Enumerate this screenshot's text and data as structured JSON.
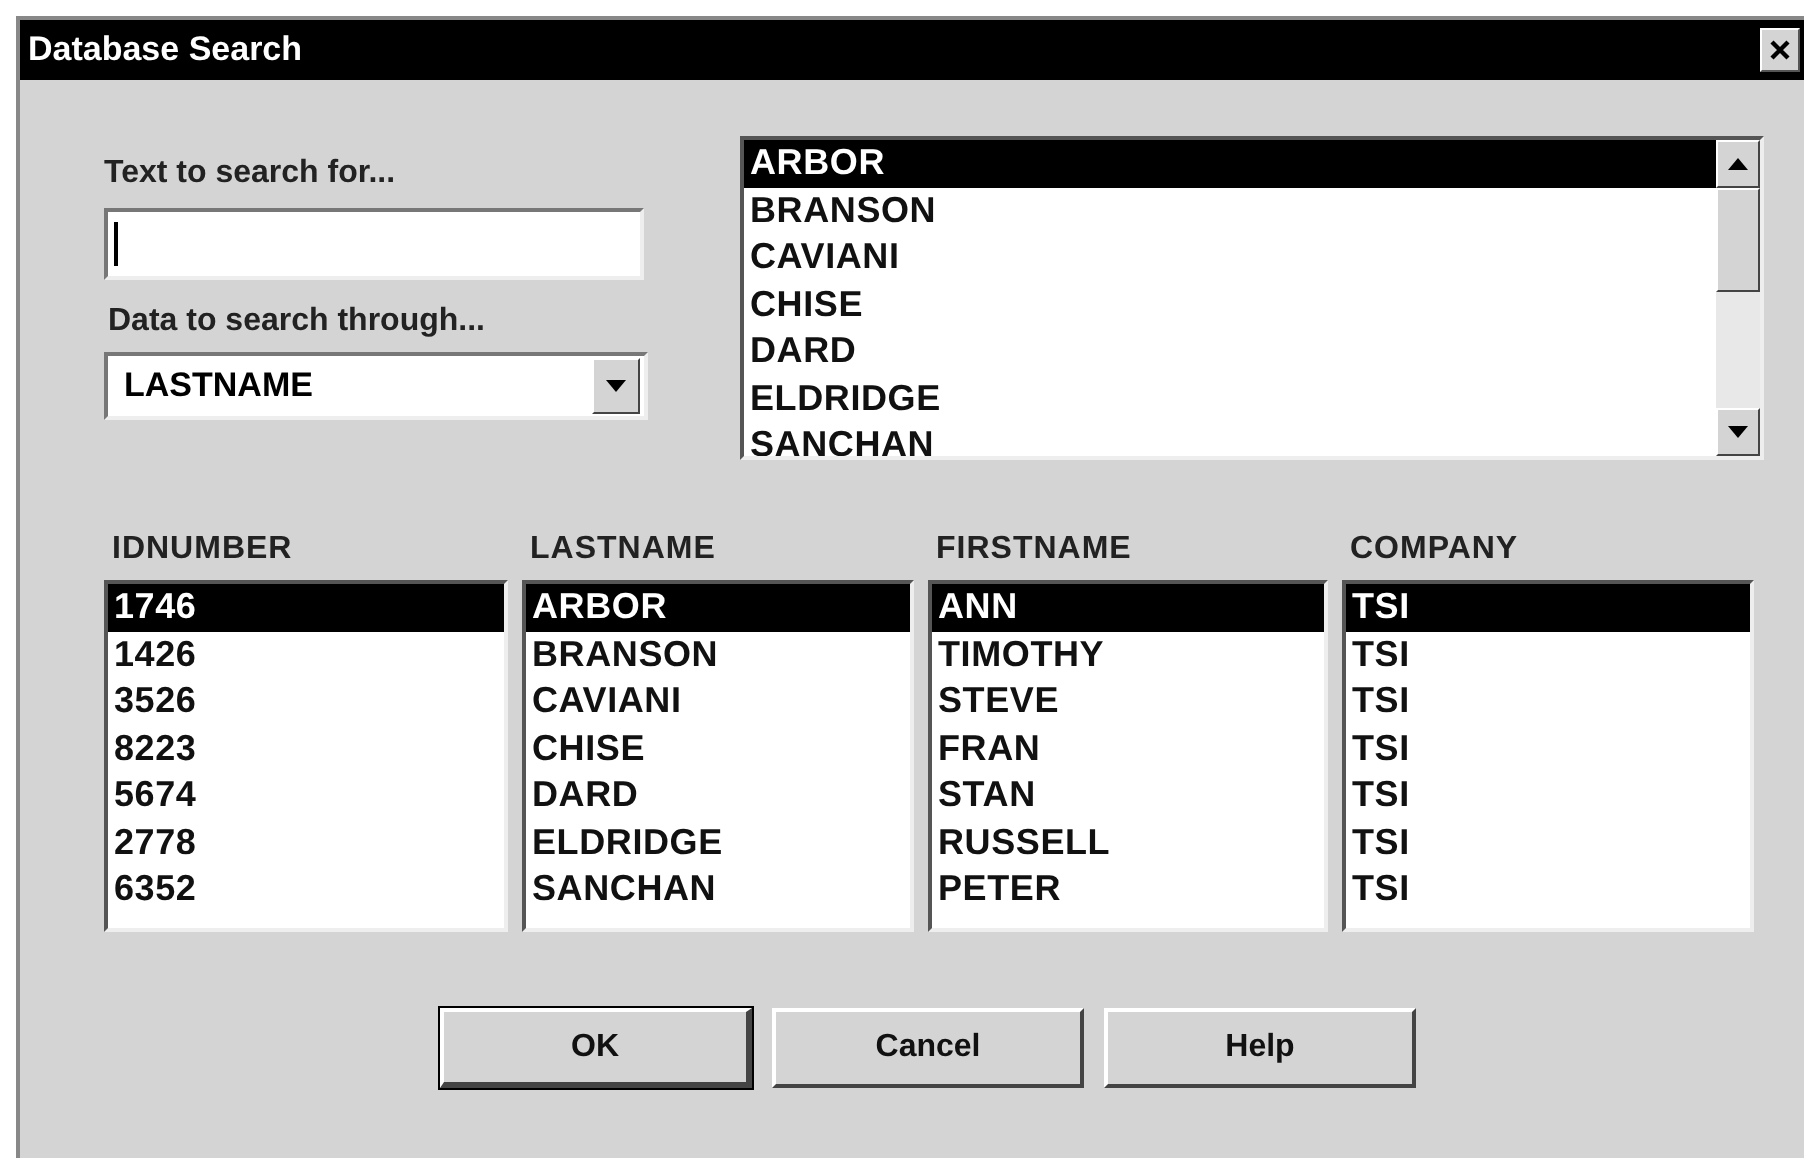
{
  "window": {
    "title": "Database Search"
  },
  "search_field": {
    "label": "Text to search for...",
    "focused": true
  },
  "search_in": {
    "label": "Data to search through...",
    "value": "LASTNAME"
  },
  "match_list": {
    "items": [
      {
        "label": "ARBOR",
        "selected": true
      },
      {
        "label": "BRANSON",
        "selected": false
      },
      {
        "label": "CAVIANI",
        "selected": false
      },
      {
        "label": "CHISE",
        "selected": false
      },
      {
        "label": "DARD",
        "selected": false
      },
      {
        "label": "ELDRIDGE",
        "selected": false
      },
      {
        "label": "SANCHAN",
        "selected": false
      }
    ]
  },
  "columns": [
    {
      "heading": "IDNUMBER",
      "items": [
        {
          "label": "1746",
          "selected": true
        },
        {
          "label": "1426",
          "selected": false
        },
        {
          "label": "3526",
          "selected": false
        },
        {
          "label": "8223",
          "selected": false
        },
        {
          "label": "5674",
          "selected": false
        },
        {
          "label": "2778",
          "selected": false
        },
        {
          "label": "6352",
          "selected": false
        }
      ]
    },
    {
      "heading": "LASTNAME",
      "items": [
        {
          "label": "ARBOR",
          "selected": true
        },
        {
          "label": "BRANSON",
          "selected": false
        },
        {
          "label": "CAVIANI",
          "selected": false
        },
        {
          "label": "CHISE",
          "selected": false
        },
        {
          "label": "DARD",
          "selected": false
        },
        {
          "label": "ELDRIDGE",
          "selected": false
        },
        {
          "label": "SANCHAN",
          "selected": false
        }
      ]
    },
    {
      "heading": "FIRSTNAME",
      "items": [
        {
          "label": "ANN",
          "selected": true
        },
        {
          "label": "TIMOTHY",
          "selected": false
        },
        {
          "label": "STEVE",
          "selected": false
        },
        {
          "label": "FRAN",
          "selected": false
        },
        {
          "label": "STAN",
          "selected": false
        },
        {
          "label": "RUSSELL",
          "selected": false
        },
        {
          "label": "PETER",
          "selected": false
        }
      ]
    },
    {
      "heading": "COMPANY",
      "items": [
        {
          "label": "TSI",
          "selected": true
        },
        {
          "label": "TSI",
          "selected": false
        },
        {
          "label": "TSI",
          "selected": false
        },
        {
          "label": "TSI",
          "selected": false
        },
        {
          "label": "TSI",
          "selected": false
        },
        {
          "label": "TSI",
          "selected": false
        },
        {
          "label": "TSI",
          "selected": false
        }
      ]
    }
  ],
  "buttons": [
    {
      "label": "OK",
      "default": true
    },
    {
      "label": "Cancel",
      "default": false
    },
    {
      "label": "Help",
      "default": false
    }
  ]
}
